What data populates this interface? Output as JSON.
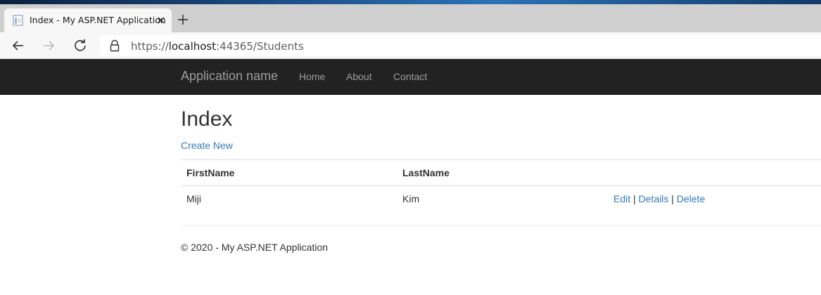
{
  "browser": {
    "tab_title": "Index - My ASP.NET Application",
    "url_scheme": "https://",
    "url_host": "localhost",
    "url_rest": ":44365/Students"
  },
  "navbar": {
    "brand": "Application name",
    "links": [
      "Home",
      "About",
      "Contact"
    ]
  },
  "main": {
    "title": "Index",
    "create_link": "Create New",
    "table": {
      "headers": [
        "FirstName",
        "LastName"
      ],
      "rows": [
        {
          "first_name": "Miji",
          "last_name": "Kim",
          "actions": [
            "Edit",
            "Details",
            "Delete"
          ],
          "separator": "|"
        }
      ]
    }
  },
  "footer": {
    "text": "© 2020 - My ASP.NET Application"
  },
  "colors": {
    "navbar_bg": "#222222",
    "link": "#337ab7",
    "nav_text": "#9d9d9d"
  }
}
